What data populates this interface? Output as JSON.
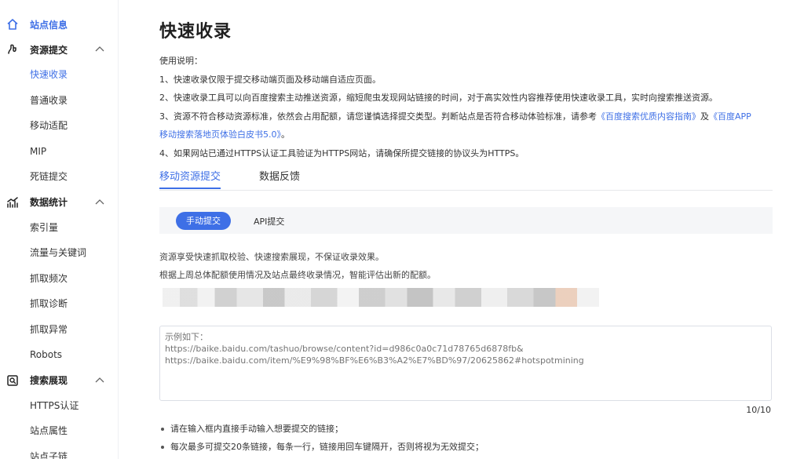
{
  "sidebar": {
    "site_info": "站点信息",
    "groups": [
      {
        "label": "资源提交",
        "items": [
          "快速收录",
          "普通收录",
          "移动适配",
          "MIP",
          "死链提交"
        ]
      },
      {
        "label": "数据统计",
        "items": [
          "索引量",
          "流量与关键词",
          "抓取频次",
          "抓取诊断",
          "抓取异常",
          "Robots"
        ]
      },
      {
        "label": "搜索展现",
        "items": [
          "HTTPS认证",
          "站点属性",
          "站点子链"
        ]
      }
    ],
    "active_item": "快速收录",
    "accent_color": "#3e6fe6"
  },
  "main": {
    "title": "快速收录",
    "instructions": {
      "heading": "使用说明：",
      "line1": "1、快速收录仅限于提交移动端页面及移动端自适应页面。",
      "line2": "2、快速收录工具可以向百度搜索主动推送资源，缩短爬虫发现网站链接的时间，对于高实效性内容推荐使用快速收录工具，实时向搜索推送资源。",
      "line3_pre": "3、资源不符合移动资源标准，依然会占用配额，请您谨慎选择提交类型。判断站点是否符合移动体验标准，请参考",
      "link1": "《百度搜索优质内容指南》",
      "line3_mid": "及",
      "link2a": "《百度APP",
      "link2b": "移动搜索落地页体验白皮书5.0》",
      "line3_end": "。",
      "line4": "4、如果网站已通过HTTPS认证工具验证为HTTPS网站，请确保所提交链接的协议头为HTTPS。"
    },
    "tabs": [
      {
        "label": "移动资源提交",
        "active": true
      },
      {
        "label": "数据反馈",
        "active": false
      }
    ],
    "subtabs": [
      {
        "label": "手动提交",
        "active": true
      },
      {
        "label": "API提交",
        "active": false
      }
    ],
    "note1": "资源享受快速抓取校验、快速搜索展现，不保证收录效果。",
    "note2": "根据上周总体配额使用情况及站点最终收录情况，智能评估出新的配额。",
    "textarea_placeholder": "示例如下：\nhttps://baike.baidu.com/tashuo/browse/content?id=d986c0a0c71d78765d6878fb&\nhttps://baike.baidu.com/item/%E9%98%BF%E6%B3%A2%E7%BD%97/20625862#hotspotmining",
    "counter": "10/10",
    "bullets": [
      "请在输入框内直接手动输入想要提交的链接；",
      "每次最多可提交20条链接，每条一行，链接用回车键隔开，否则将视为无效提交；"
    ]
  }
}
